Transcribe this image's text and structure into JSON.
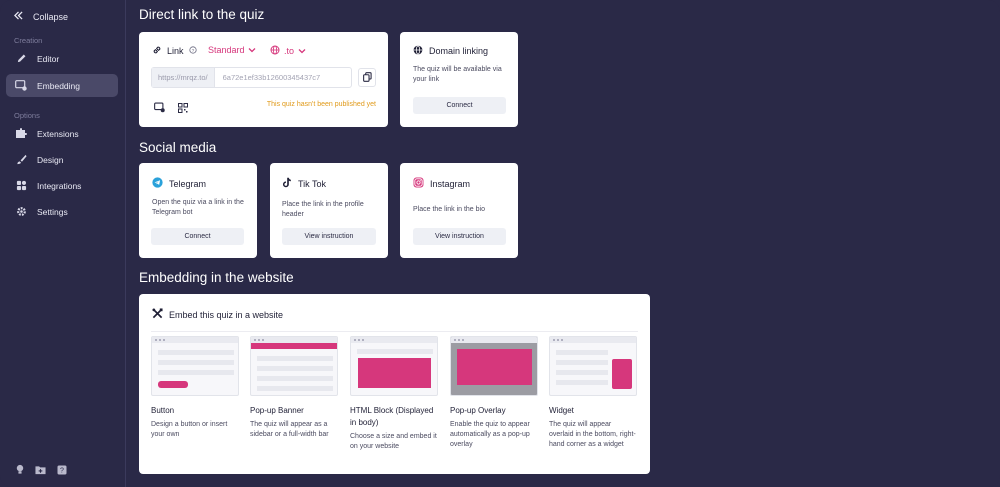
{
  "sidebar": {
    "collapse_label": "Collapse",
    "section_creation": "Creation",
    "section_options": "Options",
    "items": [
      {
        "label": "Editor",
        "icon": "pencil-icon"
      },
      {
        "label": "Embedding",
        "icon": "embed-icon",
        "active": true
      },
      {
        "label": "Extensions",
        "icon": "puzzle-icon"
      },
      {
        "label": "Design",
        "icon": "brush-icon"
      },
      {
        "label": "Integrations",
        "icon": "integrations-icon"
      },
      {
        "label": "Settings",
        "icon": "gear-icon"
      }
    ],
    "bottom_icons": [
      "lightbulb-icon",
      "folder-add-icon",
      "help-icon"
    ]
  },
  "direct_link": {
    "section_title": "Direct link to the quiz",
    "link_label": "Link",
    "mode_select": "Standard",
    "domain_select": ".to",
    "url_prefix": "https://mrqz.to/",
    "url_code": "6a72e1ef33b12600345437c7",
    "warning": "This quiz hasn't been published yet"
  },
  "domain_linking": {
    "title": "Domain linking",
    "description": "The quiz will be available via your link",
    "button": "Connect"
  },
  "social": {
    "section_title": "Social media",
    "cards": [
      {
        "title": "Telegram",
        "description": "Open the quiz via a link in the Telegram bot",
        "button": "Connect"
      },
      {
        "title": "Tik Tok",
        "description": "Place the link in the profile header",
        "button": "View instruction"
      },
      {
        "title": "Instagram",
        "description": "Place the link in the bio",
        "button": "View instruction"
      }
    ]
  },
  "embedding": {
    "section_title": "Embedding in the website",
    "card_title": "Embed this quiz in a website",
    "options": [
      {
        "title": "Button",
        "description": "Design a button or insert your own"
      },
      {
        "title": "Pop-up Banner",
        "description": "The quiz will appear as a sidebar or a full-width bar"
      },
      {
        "title": "HTML Block (Displayed in body)",
        "description": "Choose a size and embed it on your website"
      },
      {
        "title": "Pop-up Overlay",
        "description": "Enable the quiz to appear automatically as a pop-up overlay"
      },
      {
        "title": "Widget",
        "description": "The quiz will appear overlaid in the bottom, right-hand corner as a widget"
      }
    ]
  },
  "colors": {
    "background": "#2a2947",
    "accent_pink": "#d6377c",
    "warning": "#e09a1a",
    "active_item": "#4a4968"
  }
}
